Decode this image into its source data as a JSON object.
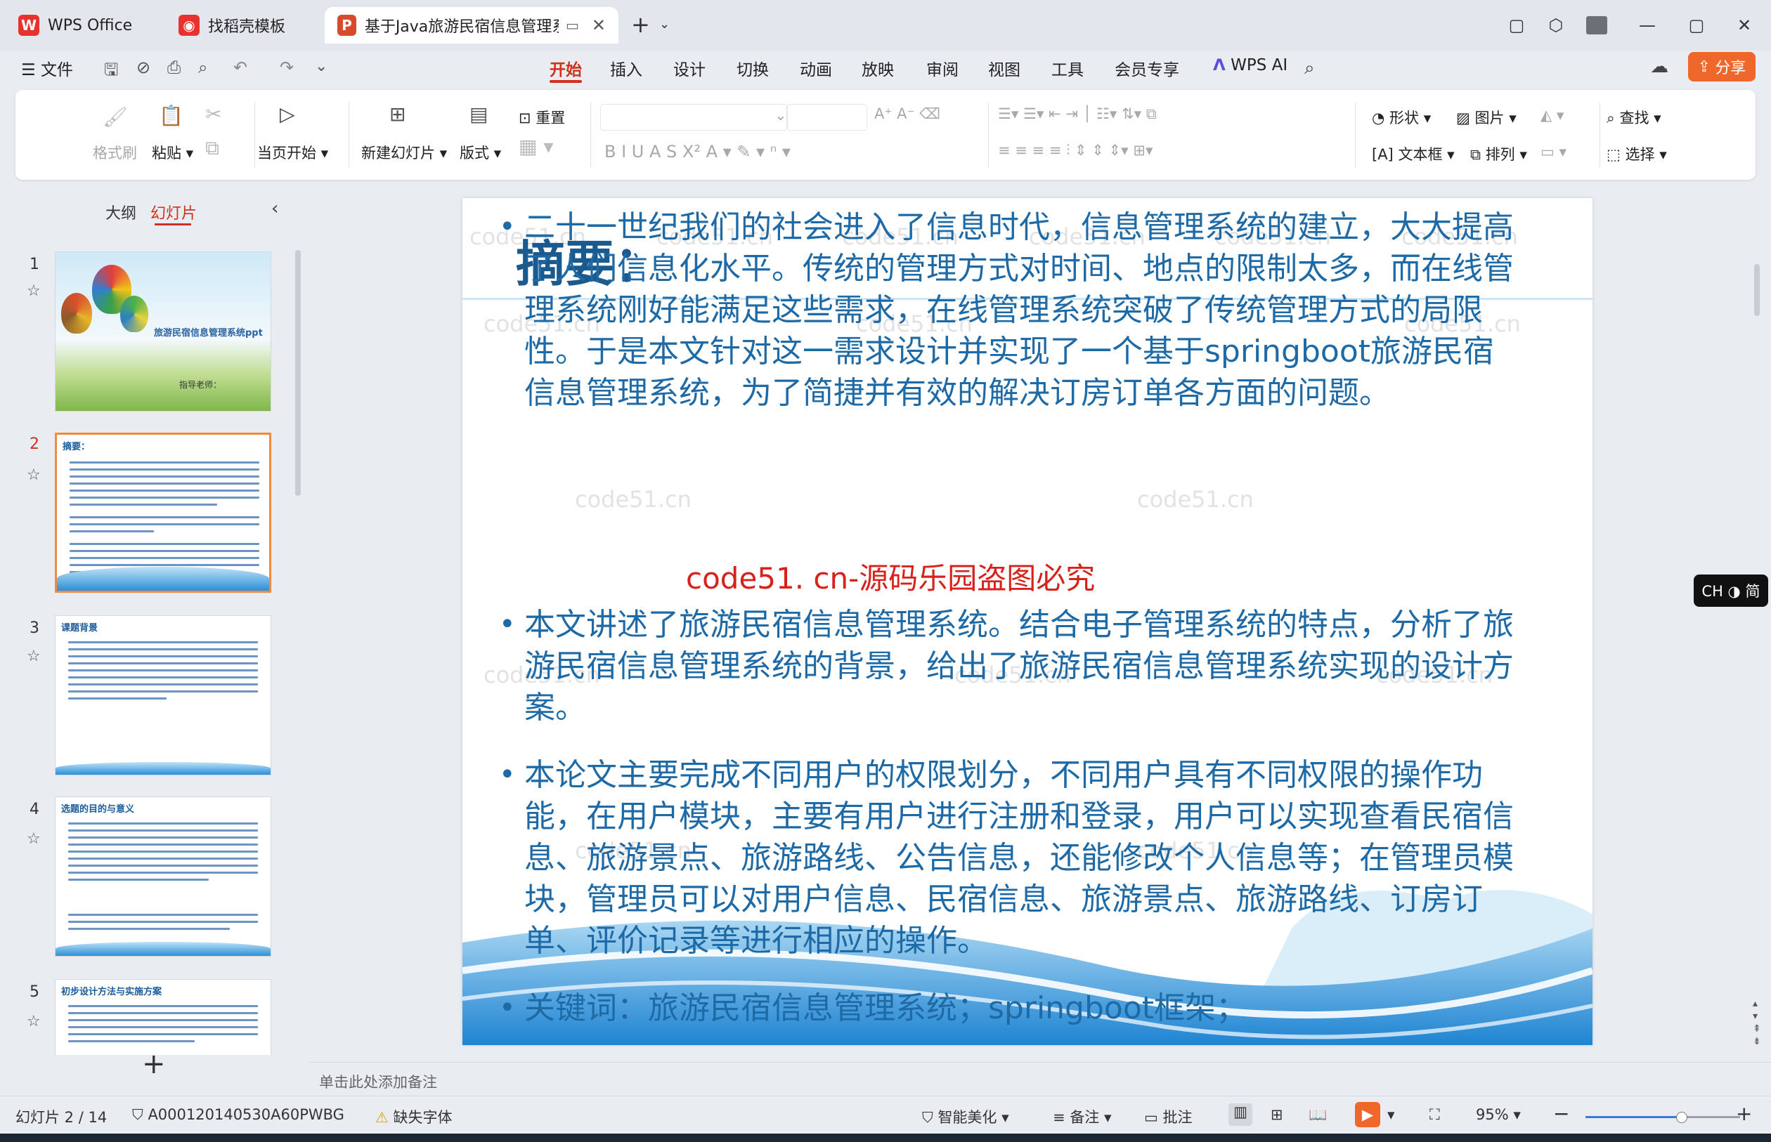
{
  "app": {
    "name": "WPS Office",
    "accent_color": "#d0301c"
  },
  "tabs": [
    {
      "label": "WPS Office",
      "icon": "wps-logo-icon"
    },
    {
      "label": "找稻壳模板",
      "icon": "docer-icon"
    },
    {
      "label": "基于Java旅游民宿信息管理系",
      "icon": "ppt-file-icon",
      "active": true
    }
  ],
  "menu": {
    "file_label": "文件",
    "items": [
      "开始",
      "插入",
      "设计",
      "切换",
      "动画",
      "放映",
      "审阅",
      "视图",
      "工具",
      "会员专享"
    ],
    "active": "开始",
    "ai_label": "WPS AI",
    "share_label": "分享"
  },
  "ribbon": {
    "format_painter": "格式刷",
    "paste": "粘贴",
    "play_from_current": "当页开始",
    "new_slide": "新建幻灯片",
    "layout": "版式",
    "reset": "重置",
    "shape": "形状",
    "picture": "图片",
    "textbox": "文本框",
    "arrange": "排列",
    "find": "查找",
    "select": "选择"
  },
  "left_panel": {
    "tab_outline": "大纲",
    "tab_slides": "幻灯片",
    "slides": [
      {
        "number": "1",
        "title": "旅游民宿信息管理系统ppt",
        "subtitle": "指导老师："
      },
      {
        "number": "2",
        "title": "摘要：",
        "selected": true
      },
      {
        "number": "3",
        "title": "课题背景"
      },
      {
        "number": "4",
        "title": "选题的目的与意义"
      },
      {
        "number": "5",
        "title": "初步设计方法与实施方案"
      }
    ]
  },
  "slide": {
    "title": "摘要：",
    "bullets": [
      "二十一世纪我们的社会进入了信息时代，信息管理系统的建立，大大提高了人们信息化水平。传统的管理方式对时间、地点的限制太多，而在线管理系统刚好能满足这些需求，在线管理系统突破了传统管理方式的局限性。于是本文针对这一需求设计并实现了一个基于springboot旅游民宿信息管理系统，为了简捷并有效的解决订房订单各方面的问题。",
      "本文讲述了旅游民宿信息管理系统。结合电子管理系统的特点，分析了旅游民宿信息管理系统的背景，给出了旅游民宿信息管理系统实现的设计方案。",
      "本论文主要完成不同用户的权限划分，不同用户具有不同权限的操作功能，在用户模块，主要有用户进行注册和登录，用户可以实现查看民宿信息、旅游景点、旅游路线、公告信息，还能修改个人信息等；在管理员模块，管理员可以对用户信息、民宿信息、旅游景点、旅游路线、订房订单、评价记录等进行相应的操作。",
      "关键词：旅游民宿信息管理系统；springboot框架；"
    ],
    "red_watermark": "code51. cn-源码乐园盗图必究",
    "bg_watermark": "code51.cn"
  },
  "notes_placeholder": "单击此处添加备注",
  "ime": "CH ◑ 简",
  "status": {
    "slide_counter": "幻灯片 2 / 14",
    "doc_id": "A000120140530A60PWBG",
    "missing_font": "缺失字体",
    "beautify": "智能美化",
    "notes": "备注",
    "comments": "批注",
    "zoom": "95%",
    "zoom_fraction": 0.62
  }
}
